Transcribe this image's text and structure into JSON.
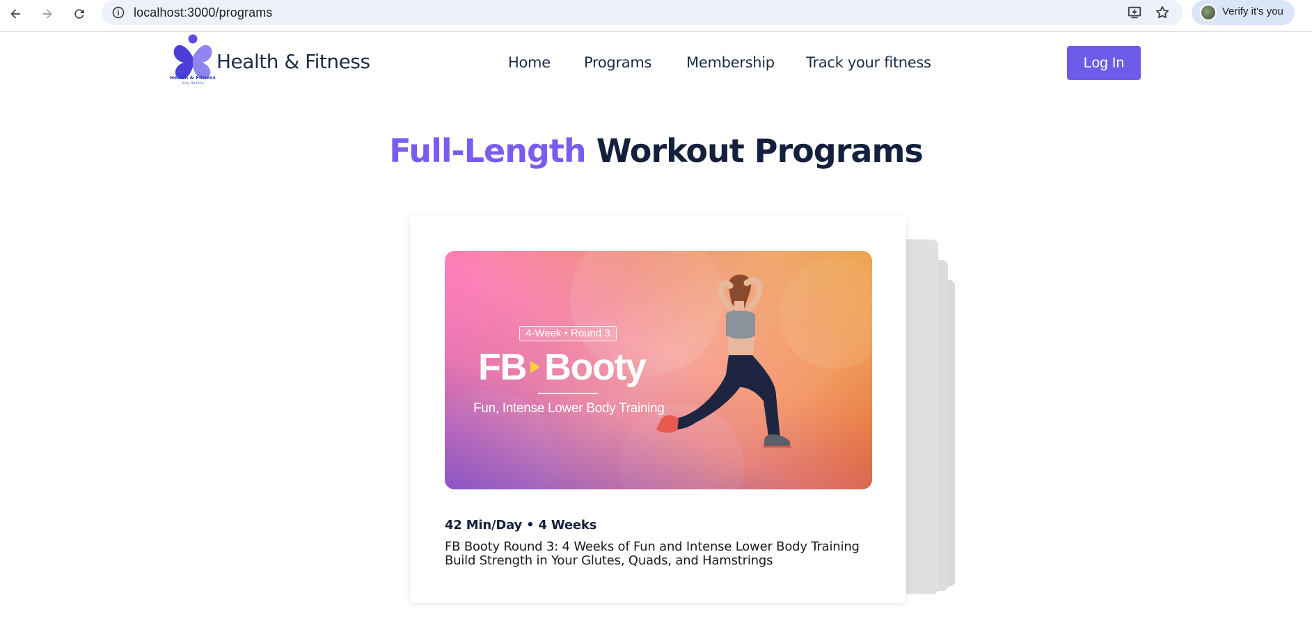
{
  "browser": {
    "url": "localhost:3000/programs",
    "profile_label": "Verify it's you",
    "icons": [
      "back-arrow-icon",
      "forward-arrow-icon",
      "reload-icon",
      "site-info-icon",
      "install-app-icon",
      "bookmark-star-icon",
      "profile-avatar-icon"
    ]
  },
  "header": {
    "logo_caption": "Health & Fitness",
    "logo_tagline": "Stay Healthy",
    "brand_name": "Health & Fitness",
    "nav": [
      "Home",
      "Programs",
      "Membership",
      "Track your fitness"
    ],
    "login_label": "Log In"
  },
  "page": {
    "heading_accent": "Full-Length",
    "heading_rest": "Workout Programs"
  },
  "program_card": {
    "image": {
      "badge": "4-Week • Round 3",
      "title_left": "FB",
      "title_right": "Booty",
      "subtitle": "Fun, Intense Lower Body Training"
    },
    "meta": "42 Min/Day • 4 Weeks",
    "description_line1": "FB Booty Round 3: 4 Weeks of Fun and Intense Lower Body Training",
    "description_line2": "Build Strength in Your Glutes, Quads, and Hamstrings"
  },
  "colors": {
    "accent": "#7a5cf0",
    "button": "#6c5ce7",
    "text_dark": "#14213d"
  }
}
